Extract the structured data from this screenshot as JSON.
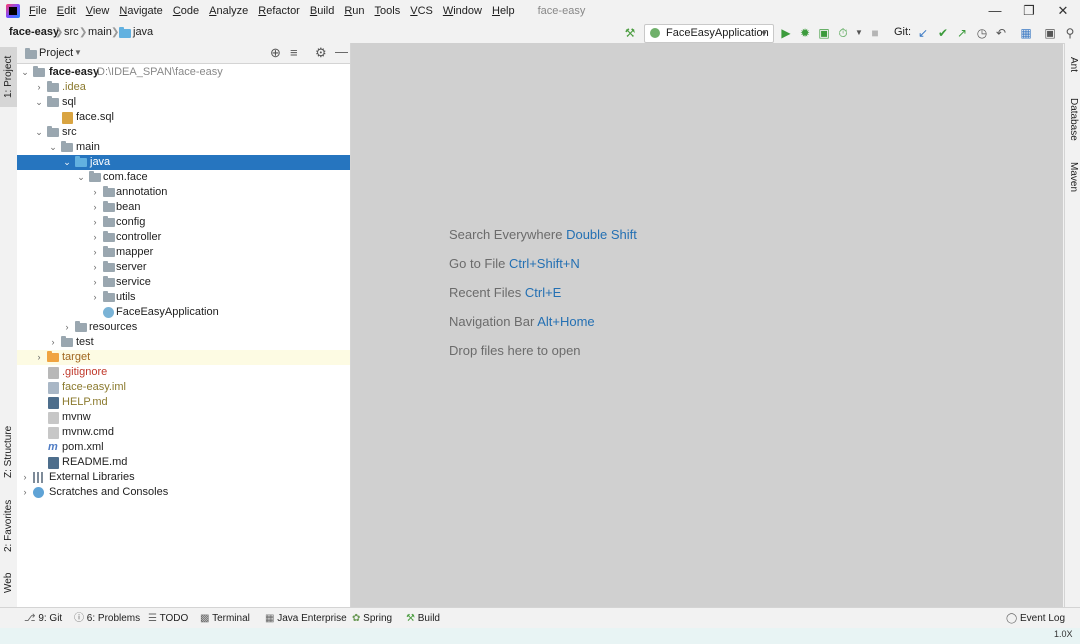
{
  "window": {
    "title": "face-easy"
  },
  "menu": [
    "File",
    "Edit",
    "View",
    "Navigate",
    "Code",
    "Analyze",
    "Refactor",
    "Build",
    "Run",
    "Tools",
    "VCS",
    "Window",
    "Help"
  ],
  "breadcrumb": {
    "project": "face-easy",
    "src": "src",
    "main": "main",
    "java": "java"
  },
  "toolbar": {
    "run_config": "FaceEasyApplication",
    "git_label": "Git:"
  },
  "project_panel": {
    "title": "Project"
  },
  "tree": {
    "root": "face-easy",
    "root_path": "D:\\IDEA_SPAN\\face-easy",
    "idea": ".idea",
    "sql": "sql",
    "face_sql": "face.sql",
    "src": "src",
    "main": "main",
    "java": "java",
    "com_face": "com.face",
    "annotation": "annotation",
    "bean": "bean",
    "config": "config",
    "controller": "controller",
    "mapper": "mapper",
    "server": "server",
    "service": "service",
    "utils": "utils",
    "app": "FaceEasyApplication",
    "resources": "resources",
    "test": "test",
    "target": "target",
    "gitignore": ".gitignore",
    "iml": "face-easy.iml",
    "help": "HELP.md",
    "mvnw": "mvnw",
    "mvnw_cmd": "mvnw.cmd",
    "pom": "pom.xml",
    "readme": "README.md",
    "ext_libs": "External Libraries",
    "scratches": "Scratches and Consoles"
  },
  "left_tabs": {
    "project": "1: Project",
    "structure": "Z: Structure",
    "favorites": "2: Favorites",
    "web": "Web"
  },
  "right_tabs": {
    "ant": "Ant",
    "database": "Database",
    "maven": "Maven"
  },
  "editor_hints": [
    {
      "text": "Search Everywhere",
      "key": "Double Shift"
    },
    {
      "text": "Go to File",
      "key": "Ctrl+Shift+N"
    },
    {
      "text": "Recent Files",
      "key": "Ctrl+E"
    },
    {
      "text": "Navigation Bar",
      "key": "Alt+Home"
    },
    {
      "text": "Drop files here to open",
      "key": ""
    }
  ],
  "status_tabs": {
    "git": "9: Git",
    "problems": "6: Problems",
    "todo": "TODO",
    "terminal": "Terminal",
    "java_ee": "Java Enterprise",
    "spring": "Spring",
    "build": "Build",
    "event_log": "Event Log"
  },
  "zoom": "1.0X",
  "colors": {
    "selection": "#2675bf",
    "link_key": "#2470b3",
    "editor_bg": "#d0d0d0",
    "excluded": "#fdfbe3"
  }
}
